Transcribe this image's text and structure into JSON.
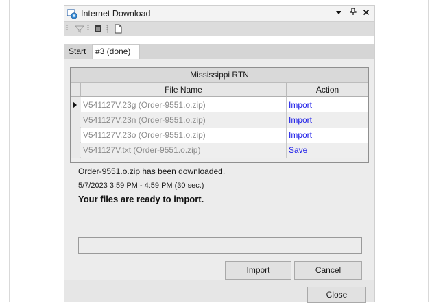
{
  "window": {
    "title": "Internet Download",
    "controls": [
      "dropdown",
      "pin",
      "close"
    ]
  },
  "toolbar": {
    "items": [
      "filter-icon",
      "stop-icon",
      "new-document-icon"
    ]
  },
  "tabs": [
    {
      "label": "Start",
      "active": false
    },
    {
      "label": "#3 (done)",
      "active": true
    }
  ],
  "grid": {
    "group_title": "Mississippi RTN",
    "columns": [
      "File Name",
      "Action"
    ],
    "rows": [
      {
        "file": "V541127V.23g   (Order-9551.o.zip)",
        "action": "Import",
        "current": true
      },
      {
        "file": "V541127V.23n   (Order-9551.o.zip)",
        "action": "Import",
        "current": false
      },
      {
        "file": "V541127V.23o   (Order-9551.o.zip)",
        "action": "Import",
        "current": false
      },
      {
        "file": "V541127V.txt   (Order-9551.o.zip)",
        "action": "Save",
        "current": false
      }
    ]
  },
  "status": {
    "downloaded": "Order-9551.o.zip has been downloaded.",
    "time_range": "5/7/2023 3:59 PM - 4:59 PM (30 sec.)",
    "ready": "Your files are ready to import."
  },
  "progress": {
    "value": 0
  },
  "buttons": {
    "import": "Import",
    "cancel": "Cancel",
    "close": "Close"
  },
  "colors": {
    "link": "#1a1ae8",
    "window_bg": "#ececec",
    "titlebar_bg": "#f3f3f3"
  }
}
